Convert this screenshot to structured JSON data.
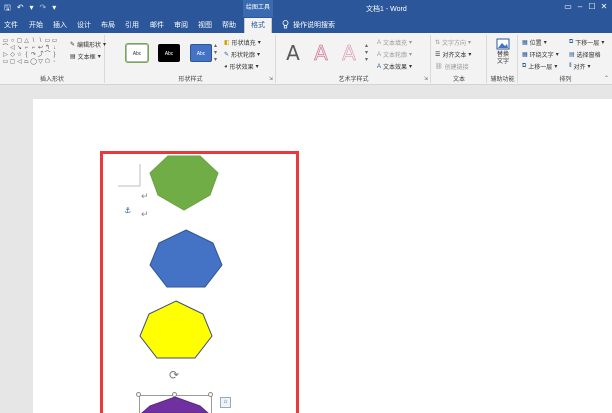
{
  "titlebar": {
    "qat": {
      "save": "🖫",
      "undo": "↶",
      "undo_menu": "▾",
      "redo": "↷",
      "customize": "▾"
    },
    "context_tab": "绘图工具",
    "document_title": "文档1 - Word",
    "user": "",
    "controls": {
      "ribbon_options": "▭",
      "minimize": "–",
      "maximize": "☐",
      "close": "✕"
    }
  },
  "tabs": [
    "文件",
    "开始",
    "插入",
    "设计",
    "布局",
    "引用",
    "邮件",
    "审阅",
    "视图",
    "帮助",
    "格式"
  ],
  "active_tab": "格式",
  "tell_me": {
    "icon": "lightbulb-icon",
    "label": "操作说明搜索"
  },
  "ribbon": {
    "insert_shapes": {
      "label": "插入形状",
      "edit_shape": "编辑形状",
      "text_box": "文本框",
      "glyphs": [
        "▭",
        "○",
        "▢",
        "△",
        "\\",
        "\\",
        "▭",
        "▭",
        "⌒",
        "◁",
        "↘",
        "⌐",
        "⌐",
        "↩",
        "↰",
        "↓",
        "▷",
        "◇",
        "☆",
        "{",
        "↷",
        "⤴",
        "⌒",
        "}",
        "▭",
        "▢",
        "◁",
        "⏢",
        "◯",
        "▽",
        "⬠",
        "◦"
      ]
    },
    "shape_styles": {
      "label": "形状样式",
      "presets": [
        {
          "text": "Abc",
          "bg": "#ffffff",
          "fg": "#333333",
          "border": "#b7b7b7"
        },
        {
          "text": "Abc",
          "bg": "#000000",
          "fg": "#ffffff",
          "border": "#000000"
        },
        {
          "text": "Abc",
          "bg": "#4472c4",
          "fg": "#ffffff",
          "border": "#2f5597"
        }
      ],
      "fill": "形状填充",
      "outline": "形状轮廓",
      "effects": "形状效果"
    },
    "wordart_styles": {
      "label": "艺术字样式",
      "samples": [
        "A",
        "A",
        "A"
      ],
      "text_fill": "文本填充",
      "text_outline": "文本轮廓",
      "text_effects": "文本效果"
    },
    "text": {
      "label": "文本",
      "direction": "文字方向",
      "align": "对齐文本",
      "link": "创建链接"
    },
    "accessibility": {
      "label": "辅助功能",
      "alt_text": "替换文字"
    },
    "arrange": {
      "label": "排列",
      "position": "位置",
      "wrap": "环绕文字",
      "bring_forward": "上移一层",
      "send_backward": "下移一层",
      "selection_pane": "选择窗格",
      "align": "对齐"
    }
  },
  "document": {
    "shapes": [
      {
        "name": "green-heptagon",
        "fill": "#70ad47",
        "stroke": "#6aa242"
      },
      {
        "name": "blue-heptagon",
        "fill": "#4472c4",
        "stroke": "#2f5597"
      },
      {
        "name": "yellow-heptagon",
        "fill": "#ffff00",
        "stroke": "#3e4e79"
      },
      {
        "name": "purple-heptagon",
        "fill": "#7030a0",
        "stroke": "#5b2a8a"
      }
    ],
    "frame_color": "#e8393d"
  }
}
